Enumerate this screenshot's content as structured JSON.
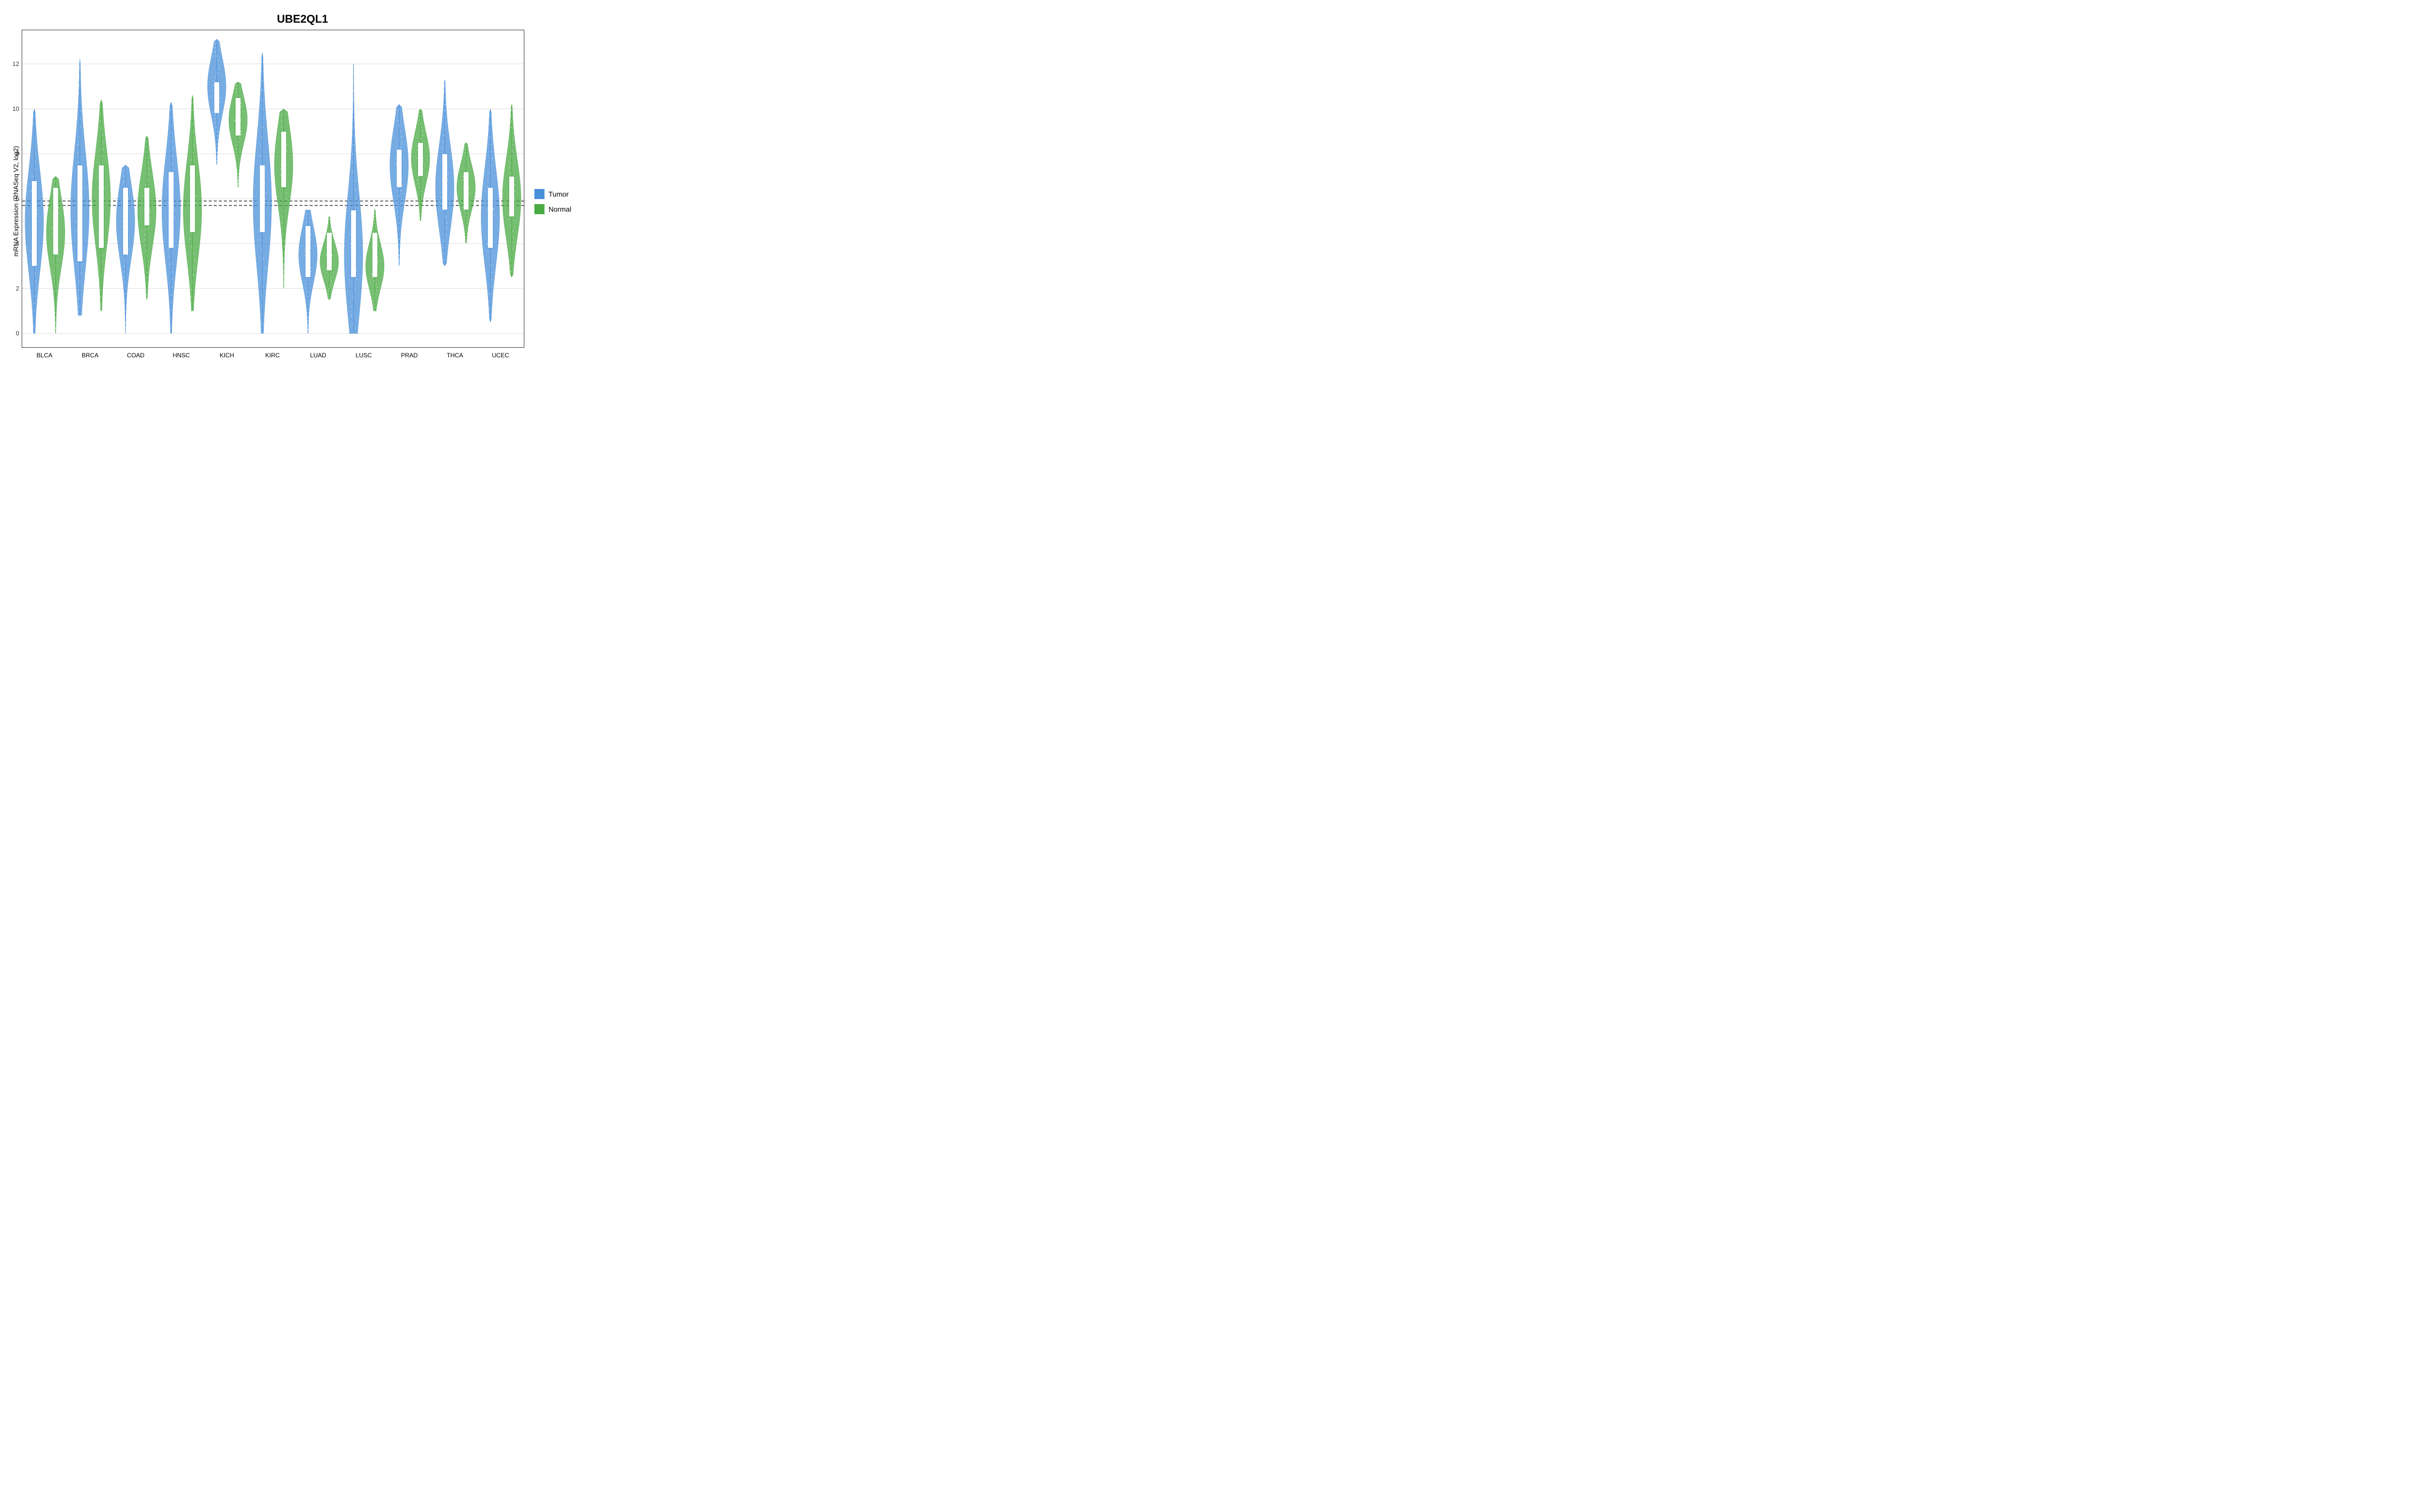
{
  "title": "UBE2QL1",
  "yAxisLabel": "mRNA Expression (RNASeq V2, log2)",
  "yTicks": [
    0,
    2,
    4,
    6,
    8,
    10,
    12
  ],
  "yMin": -0.5,
  "yMax": 13.5,
  "dashedLineValues": [
    5.7,
    5.9
  ],
  "xLabels": [
    "BLCA",
    "BRCA",
    "COAD",
    "HNSC",
    "KICH",
    "KIRC",
    "LUAD",
    "LUSC",
    "PRAD",
    "THCA",
    "UCEC"
  ],
  "legend": {
    "items": [
      {
        "label": "Tumor",
        "color": "#4a90d9"
      },
      {
        "label": "Normal",
        "color": "#4aaa44"
      }
    ]
  },
  "colors": {
    "tumor": "#4a90d9",
    "normal": "#4aaa44",
    "tumorLight": "#a8c8ee",
    "normalLight": "#a8d8a0"
  },
  "violins": [
    {
      "id": "BLCA",
      "tumor": {
        "min": 0.0,
        "q1": 3.0,
        "median": 5.5,
        "q3": 6.8,
        "max": 10.0,
        "mode": 5.0,
        "width": 0.6
      },
      "normal": {
        "min": 0.0,
        "q1": 3.5,
        "median": 5.0,
        "q3": 6.5,
        "max": 7.0,
        "mode": 4.5,
        "width": 0.5
      }
    },
    {
      "id": "BRCA",
      "tumor": {
        "min": 0.8,
        "q1": 3.2,
        "median": 6.0,
        "q3": 7.5,
        "max": 12.2,
        "mode": 5.5,
        "width": 0.8
      },
      "normal": {
        "min": 1.0,
        "q1": 3.8,
        "median": 6.5,
        "q3": 7.5,
        "max": 10.4,
        "mode": 6.0,
        "width": 0.7
      }
    },
    {
      "id": "COAD",
      "tumor": {
        "min": 0.0,
        "q1": 3.5,
        "median": 5.5,
        "q3": 6.5,
        "max": 7.5,
        "mode": 5.0,
        "width": 0.5
      },
      "normal": {
        "min": 1.5,
        "q1": 4.8,
        "median": 5.5,
        "q3": 6.5,
        "max": 8.8,
        "mode": 5.5,
        "width": 0.5
      }
    },
    {
      "id": "HNSC",
      "tumor": {
        "min": 0.0,
        "q1": 3.8,
        "median": 5.8,
        "q3": 7.2,
        "max": 10.3,
        "mode": 5.5,
        "width": 0.6
      },
      "normal": {
        "min": 1.0,
        "q1": 4.5,
        "median": 5.8,
        "q3": 7.5,
        "max": 10.6,
        "mode": 5.5,
        "width": 0.6
      }
    },
    {
      "id": "KICH",
      "tumor": {
        "min": 7.5,
        "q1": 9.8,
        "median": 10.8,
        "q3": 11.2,
        "max": 13.1,
        "mode": 11.0,
        "width": 1.0
      },
      "normal": {
        "min": 6.5,
        "q1": 8.8,
        "median": 9.5,
        "q3": 10.5,
        "max": 11.2,
        "mode": 9.5,
        "width": 0.8
      }
    },
    {
      "id": "KIRC",
      "tumor": {
        "min": 0.0,
        "q1": 4.5,
        "median": 6.0,
        "q3": 7.5,
        "max": 12.5,
        "mode": 5.8,
        "width": 0.6
      },
      "normal": {
        "min": 2.0,
        "q1": 6.5,
        "median": 7.5,
        "q3": 9.0,
        "max": 10.0,
        "mode": 7.5,
        "width": 0.7
      }
    },
    {
      "id": "LUAD",
      "tumor": {
        "min": 0.0,
        "q1": 2.5,
        "median": 3.8,
        "q3": 4.8,
        "max": 5.5,
        "mode": 3.5,
        "width": 0.55
      },
      "normal": {
        "min": 1.5,
        "q1": 2.8,
        "median": 3.5,
        "q3": 4.5,
        "max": 5.2,
        "mode": 3.2,
        "width": 0.5
      }
    },
    {
      "id": "LUSC",
      "tumor": {
        "min": 0.0,
        "q1": 2.5,
        "median": 3.8,
        "q3": 5.5,
        "max": 12.0,
        "mode": 3.5,
        "width": 0.55
      },
      "normal": {
        "min": 1.0,
        "q1": 2.5,
        "median": 3.2,
        "q3": 4.5,
        "max": 5.5,
        "mode": 3.0,
        "width": 0.45
      }
    },
    {
      "id": "PRAD",
      "tumor": {
        "min": 3.0,
        "q1": 6.5,
        "median": 7.5,
        "q3": 8.2,
        "max": 10.2,
        "mode": 7.5,
        "width": 0.7
      },
      "normal": {
        "min": 5.0,
        "q1": 7.0,
        "median": 7.8,
        "q3": 8.5,
        "max": 10.0,
        "mode": 7.8,
        "width": 0.6
      }
    },
    {
      "id": "THCA",
      "tumor": {
        "min": 3.0,
        "q1": 5.5,
        "median": 6.8,
        "q3": 8.0,
        "max": 11.3,
        "mode": 6.5,
        "width": 0.65
      },
      "normal": {
        "min": 4.0,
        "q1": 5.5,
        "median": 6.5,
        "q3": 7.2,
        "max": 8.5,
        "mode": 6.5,
        "width": 0.55
      }
    },
    {
      "id": "UCEC",
      "tumor": {
        "min": 0.5,
        "q1": 3.8,
        "median": 5.5,
        "q3": 6.5,
        "max": 10.0,
        "mode": 5.2,
        "width": 0.6
      },
      "normal": {
        "min": 2.5,
        "q1": 5.2,
        "median": 6.0,
        "q3": 7.0,
        "max": 10.2,
        "mode": 6.0,
        "width": 0.55
      }
    }
  ]
}
